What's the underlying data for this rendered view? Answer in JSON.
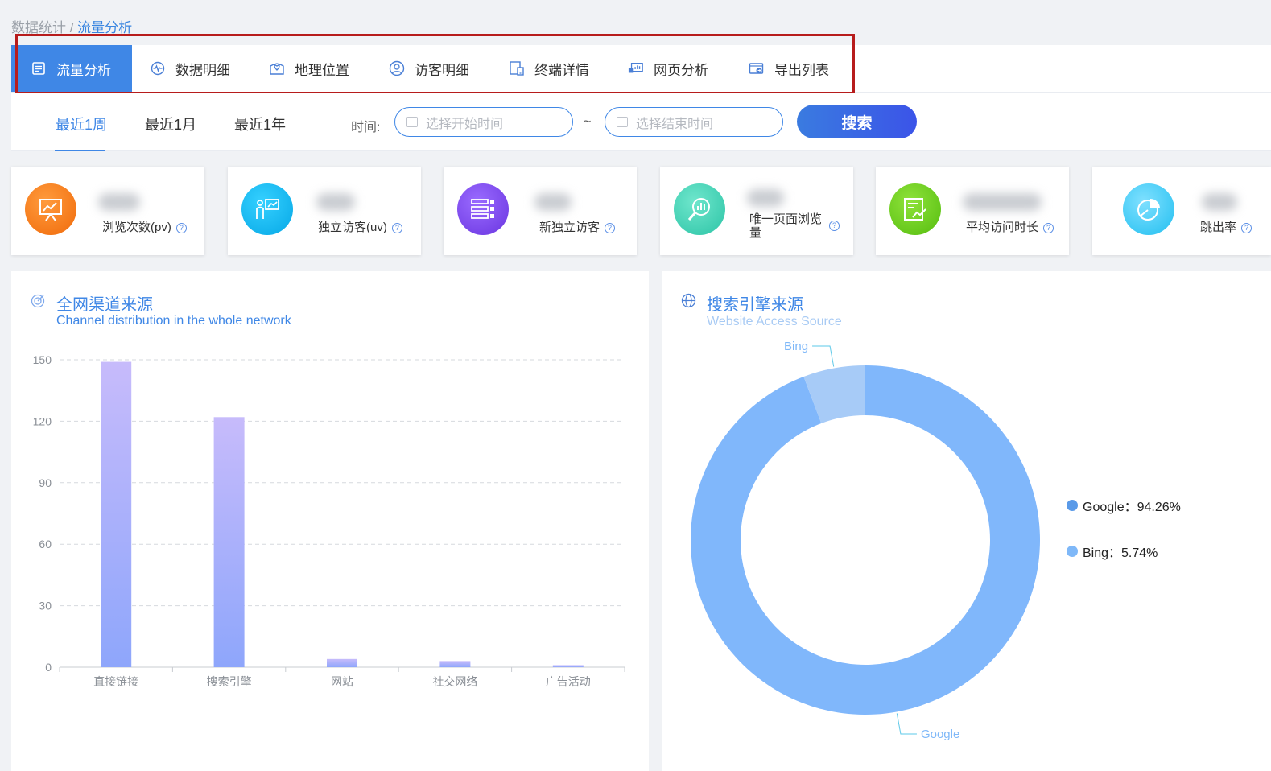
{
  "breadcrumb": {
    "parent": "数据统计",
    "separator": " / ",
    "current": "流量分析"
  },
  "tabs": [
    {
      "label": "流量分析",
      "icon": "list-doc-icon"
    },
    {
      "label": "数据明细",
      "icon": "pulse-icon"
    },
    {
      "label": "地理位置",
      "icon": "map-pin-icon"
    },
    {
      "label": "访客明细",
      "icon": "user-circle-icon"
    },
    {
      "label": "终端详情",
      "icon": "devices-icon"
    },
    {
      "label": "网页分析",
      "icon": "webpage-chart-icon"
    },
    {
      "label": "导出列表",
      "icon": "export-box-icon"
    }
  ],
  "filter": {
    "ranges": [
      "最近1周",
      "最近1月",
      "最近1年"
    ],
    "time_label": "时间:",
    "start_placeholder": "选择开始时间",
    "end_placeholder": "选择结束时间",
    "separator": "~",
    "search_label": "搜索"
  },
  "stats": [
    {
      "label": "浏览次数(pv)",
      "help": "?",
      "icon": "presentation-board-icon",
      "color": "#f5730f"
    },
    {
      "label": "独立访客(uv)",
      "help": "?",
      "icon": "presenter-icon",
      "color": "#12b5e8"
    },
    {
      "label": "新独立访客",
      "help": "?",
      "icon": "server-list-icon",
      "color": "#7a45e6"
    },
    {
      "label": "唯一页面浏览量",
      "help": "?",
      "icon": "magnifier-chart-icon",
      "color": "#3fd1b0"
    },
    {
      "label": "平均访问时长",
      "help": "?",
      "icon": "report-chart-icon",
      "color": "#63c81e"
    },
    {
      "label": "跳出率",
      "help": "?",
      "icon": "pie-chart-icon",
      "color": "#39c4f0"
    }
  ],
  "channel_panel": {
    "title": "全网渠道来源",
    "subtitle": "Channel distribution in the whole network",
    "icon": "target-icon"
  },
  "search_panel": {
    "title": "搜索引擎来源",
    "subtitle": "Website Access Source",
    "icon": "globe-icon",
    "legend": [
      {
        "text": "Google：94.26%",
        "color": "#5a9ae8"
      },
      {
        "text": "Bing：5.74%",
        "color": "#7fb8f8"
      }
    ]
  },
  "chart_data": [
    {
      "type": "bar",
      "categories": [
        "直接链接",
        "搜索引擎",
        "网站",
        "社交网络",
        "广告活动"
      ],
      "values": [
        149,
        122,
        4,
        3,
        1
      ],
      "ylim": [
        0,
        150
      ],
      "yticks": [
        "0",
        "30",
        "60",
        "90",
        "120",
        "150"
      ],
      "grid": true,
      "bar_color_top": "#c7bbfb",
      "bar_color_bottom": "#8ea6fb"
    },
    {
      "type": "pie",
      "style": "donut",
      "slices": [
        {
          "label": "Google",
          "value": 94.26,
          "color": "#80b7fb"
        },
        {
          "label": "Bing",
          "value": 5.74,
          "color": "#a7cbf7"
        }
      ]
    }
  ]
}
